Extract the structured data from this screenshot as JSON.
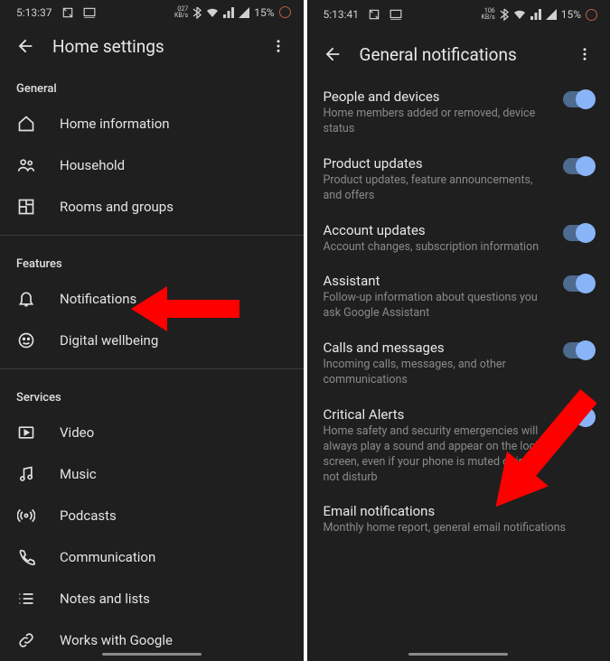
{
  "left": {
    "status": {
      "time": "5:13:37",
      "speed": "027",
      "battery": "15%"
    },
    "title": "Home settings",
    "sections": {
      "general": {
        "header": "General",
        "items": [
          "Home information",
          "Household",
          "Rooms and groups"
        ]
      },
      "features": {
        "header": "Features",
        "items": [
          "Notifications",
          "Digital wellbeing"
        ]
      },
      "services": {
        "header": "Services",
        "items": [
          "Video",
          "Music",
          "Podcasts",
          "Communication",
          "Notes and lists",
          "Works with Google"
        ]
      }
    }
  },
  "right": {
    "status": {
      "time": "5:13:41",
      "speed": "106",
      "battery": "15%"
    },
    "title": "General notifications",
    "toggles": [
      {
        "title": "People and devices",
        "sub": "Home members added or removed, device status",
        "on": true
      },
      {
        "title": "Product updates",
        "sub": "Product updates, feature announcements, and offers",
        "on": true
      },
      {
        "title": "Account updates",
        "sub": "Account changes, subscription information",
        "on": true
      },
      {
        "title": "Assistant",
        "sub": "Follow-up information about questions you ask Google Assistant",
        "on": true
      },
      {
        "title": "Calls and messages",
        "sub": "Incoming calls, messages, and other communications",
        "on": true
      },
      {
        "title": "Critical Alerts",
        "sub": "Home safety and security emergencies will always play a sound and appear on the lock screen, even if your phone is muted or in do not disturb",
        "on": true
      },
      {
        "title": "Email notifications",
        "sub": "Monthly home report, general email notifications",
        "on": false
      }
    ]
  }
}
